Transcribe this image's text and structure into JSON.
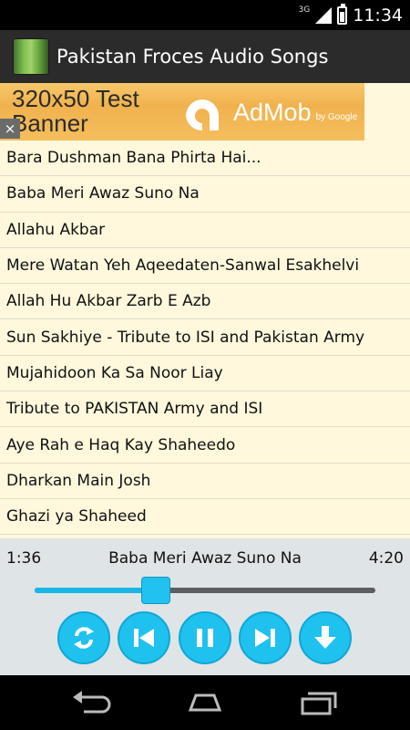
{
  "status_bar": {
    "network": "3G",
    "time": "11:34"
  },
  "app_bar": {
    "title": "Pakistan Froces Audio Songs"
  },
  "ad": {
    "banner_text": "320x50 Test Banner",
    "brand": "AdMob",
    "by": "by Google",
    "close": "×"
  },
  "songs": [
    "Bara Dushman Bana Phirta Hai...",
    "Baba Meri Awaz Suno Na",
    "Allahu Akbar",
    "Mere Watan Yeh Aqeedaten-Sanwal Esakhelvi",
    "Allah Hu Akbar Zarb E Azb",
    "Sun Sakhiye - Tribute to ISI and Pakistan Army",
    "Mujahidoon Ka Sa Noor Liay",
    "Tribute to PAKISTAN Army and ISI",
    "Aye Rah e Haq Kay Shaheedo",
    "Dharkan Main Josh",
    "Ghazi ya Shaheed"
  ],
  "player": {
    "elapsed": "1:36",
    "now_playing": "Baba Meri Awaz Suno Na",
    "total": "4:20",
    "progress": 0.356,
    "controls": [
      "repeat-icon",
      "previous-icon",
      "pause-icon",
      "next-icon",
      "download-icon"
    ],
    "accent": "#1fc1ee"
  },
  "nav_bar": {
    "buttons": [
      "back-icon",
      "home-icon",
      "recents-icon"
    ]
  }
}
